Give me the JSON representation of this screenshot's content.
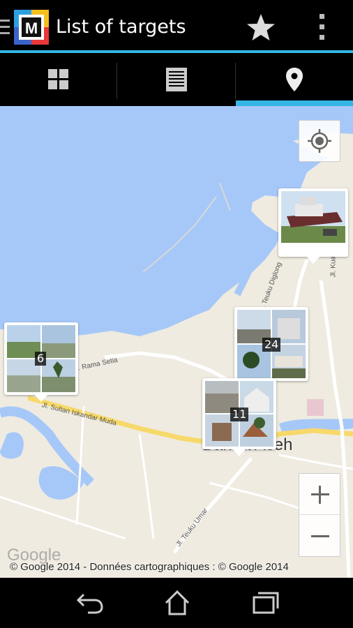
{
  "actionbar": {
    "title": "List of targets",
    "accent_color": "#33b5e5"
  },
  "icons": {
    "menu": "drawer-menu-icon",
    "logo": "app-logo-icon",
    "favorite": "star-icon",
    "overflow": "overflow-menu-icon",
    "grid": "grid-view-icon",
    "list": "list-view-icon",
    "map": "map-pin-icon",
    "my_location": "my-location-icon",
    "zoom_in": "plus-icon",
    "zoom_out": "minus-icon",
    "back": "back-icon",
    "home": "home-icon",
    "recents": "recent-apps-icon"
  },
  "tabs": [
    {
      "name": "grid",
      "selected": false
    },
    {
      "name": "list",
      "selected": false
    },
    {
      "name": "map",
      "selected": true
    }
  ],
  "map": {
    "city_label": "Banda Aceh",
    "streets": [
      "Jl. Sultan Iskandar Muda",
      "Jl. Teuku Umar",
      "Jl. Rama Setia",
      "Jl. Teuku Diglong",
      "Jl. Kuala"
    ],
    "markers": [
      {
        "id": "marker-6",
        "count": "6"
      },
      {
        "id": "marker-24",
        "count": "24"
      },
      {
        "id": "marker-11",
        "count": "11"
      },
      {
        "id": "marker-ship",
        "count": ""
      }
    ],
    "google_logo": "Google",
    "attribution": "© Google 2014 - Données cartographiques : © Google 2014"
  }
}
